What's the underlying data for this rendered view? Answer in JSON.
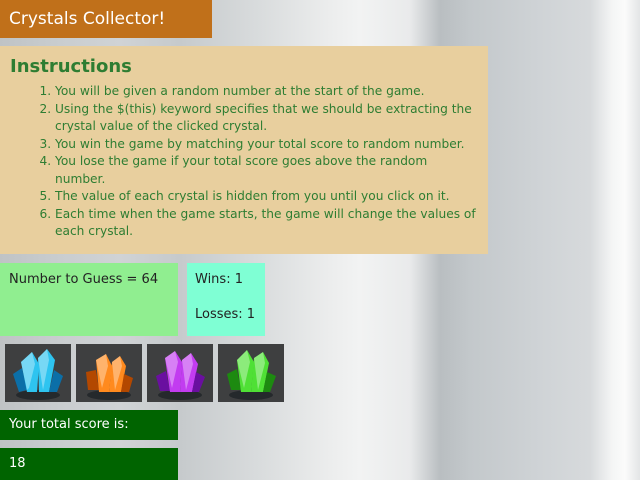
{
  "header": {
    "title": "Crystals Collector!"
  },
  "instructions": {
    "heading": "Instructions",
    "items": [
      "You will be given a random number at the start of the game.",
      "Using the $(this) keyword specifies that we should be extracting the crystal value of the clicked crystal.",
      "You win the game by matching your total score to random number.",
      "You lose the game if your total score goes above the random number.",
      "The value of each crystal is hidden from you until you click on it.",
      "Each time when the game starts, the game will change the values of each crystal."
    ]
  },
  "game": {
    "number_to_guess": "Number to Guess = 64",
    "wins": "Wins: 1",
    "losses": "Losses: 1",
    "score_label": "Your total score is:",
    "score_value": "18"
  },
  "crystals": [
    {
      "name": "blue-crystal",
      "color": "#2ec4f0",
      "dark": "#0b6fa8"
    },
    {
      "name": "orange-crystal",
      "color": "#ff8a1e",
      "dark": "#b34800"
    },
    {
      "name": "purple-crystal",
      "color": "#c23cf0",
      "dark": "#6a0fa0"
    },
    {
      "name": "green-crystal",
      "color": "#4fe035",
      "dark": "#1d8a10"
    }
  ],
  "colors": {
    "title_bg": "#c0701a",
    "instructions_bg": "#e8cf9e",
    "instructions_text": "#2e7d32",
    "guess_bg": "#90ee90",
    "stats_bg": "#7fffd4",
    "score_bg": "#006400"
  }
}
